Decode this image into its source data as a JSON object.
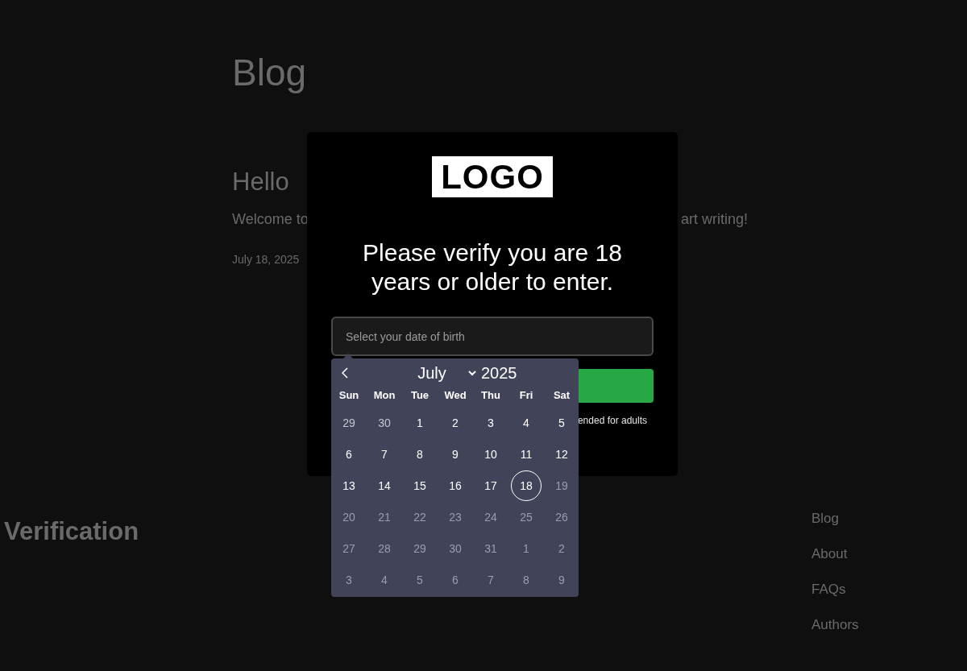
{
  "page": {
    "title": "Blog",
    "post_title": "Hello",
    "post_excerpt_start": "Welcome to",
    "post_excerpt_end": "art writing!",
    "post_date": "July 18, 2025"
  },
  "footer": {
    "site_title": "Verification",
    "nav": [
      {
        "label": "Blog"
      },
      {
        "label": "About"
      },
      {
        "label": "FAQs"
      },
      {
        "label": "Authors"
      }
    ]
  },
  "modal": {
    "logo": "LOGO",
    "heading": "Please verify you are 18 years or older to enter.",
    "date_field": {
      "placeholder": "Select your date of birth"
    },
    "disclaimer": "ended for adults"
  },
  "calendar": {
    "month": "July",
    "year": "2025",
    "weekdays": [
      "Sun",
      "Mon",
      "Tue",
      "Wed",
      "Thu",
      "Fri",
      "Sat"
    ],
    "days": [
      {
        "label": "29",
        "selected": false,
        "disabled": false,
        "outside": true
      },
      {
        "label": "30",
        "selected": false,
        "disabled": false,
        "outside": true
      },
      {
        "label": "1",
        "selected": false,
        "disabled": false,
        "outside": false
      },
      {
        "label": "2",
        "selected": false,
        "disabled": false,
        "outside": false
      },
      {
        "label": "3",
        "selected": false,
        "disabled": false,
        "outside": false
      },
      {
        "label": "4",
        "selected": false,
        "disabled": false,
        "outside": false
      },
      {
        "label": "5",
        "selected": false,
        "disabled": false,
        "outside": false
      },
      {
        "label": "6",
        "selected": false,
        "disabled": false,
        "outside": false
      },
      {
        "label": "7",
        "selected": false,
        "disabled": false,
        "outside": false
      },
      {
        "label": "8",
        "selected": false,
        "disabled": false,
        "outside": false
      },
      {
        "label": "9",
        "selected": false,
        "disabled": false,
        "outside": false
      },
      {
        "label": "10",
        "selected": false,
        "disabled": false,
        "outside": false
      },
      {
        "label": "11",
        "selected": false,
        "disabled": false,
        "outside": false
      },
      {
        "label": "12",
        "selected": false,
        "disabled": false,
        "outside": false
      },
      {
        "label": "13",
        "selected": false,
        "disabled": false,
        "outside": false
      },
      {
        "label": "14",
        "selected": false,
        "disabled": false,
        "outside": false
      },
      {
        "label": "15",
        "selected": false,
        "disabled": false,
        "outside": false
      },
      {
        "label": "16",
        "selected": false,
        "disabled": false,
        "outside": false
      },
      {
        "label": "17",
        "selected": false,
        "disabled": false,
        "outside": false
      },
      {
        "label": "18",
        "selected": true,
        "disabled": false,
        "outside": false
      },
      {
        "label": "19",
        "selected": false,
        "disabled": true,
        "outside": false
      },
      {
        "label": "20",
        "selected": false,
        "disabled": true,
        "outside": false
      },
      {
        "label": "21",
        "selected": false,
        "disabled": true,
        "outside": false
      },
      {
        "label": "22",
        "selected": false,
        "disabled": true,
        "outside": false
      },
      {
        "label": "23",
        "selected": false,
        "disabled": true,
        "outside": false
      },
      {
        "label": "24",
        "selected": false,
        "disabled": true,
        "outside": false
      },
      {
        "label": "25",
        "selected": false,
        "disabled": true,
        "outside": false
      },
      {
        "label": "26",
        "selected": false,
        "disabled": true,
        "outside": false
      },
      {
        "label": "27",
        "selected": false,
        "disabled": true,
        "outside": false
      },
      {
        "label": "28",
        "selected": false,
        "disabled": true,
        "outside": false
      },
      {
        "label": "29",
        "selected": false,
        "disabled": true,
        "outside": false
      },
      {
        "label": "30",
        "selected": false,
        "disabled": true,
        "outside": false
      },
      {
        "label": "31",
        "selected": false,
        "disabled": true,
        "outside": false
      },
      {
        "label": "1",
        "selected": false,
        "disabled": true,
        "outside": true
      },
      {
        "label": "2",
        "selected": false,
        "disabled": true,
        "outside": true
      },
      {
        "label": "3",
        "selected": false,
        "disabled": true,
        "outside": true
      },
      {
        "label": "4",
        "selected": false,
        "disabled": true,
        "outside": true
      },
      {
        "label": "5",
        "selected": false,
        "disabled": true,
        "outside": true
      },
      {
        "label": "6",
        "selected": false,
        "disabled": true,
        "outside": true
      },
      {
        "label": "7",
        "selected": false,
        "disabled": true,
        "outside": true
      },
      {
        "label": "8",
        "selected": false,
        "disabled": true,
        "outside": true
      },
      {
        "label": "9",
        "selected": false,
        "disabled": true,
        "outside": true
      }
    ]
  }
}
